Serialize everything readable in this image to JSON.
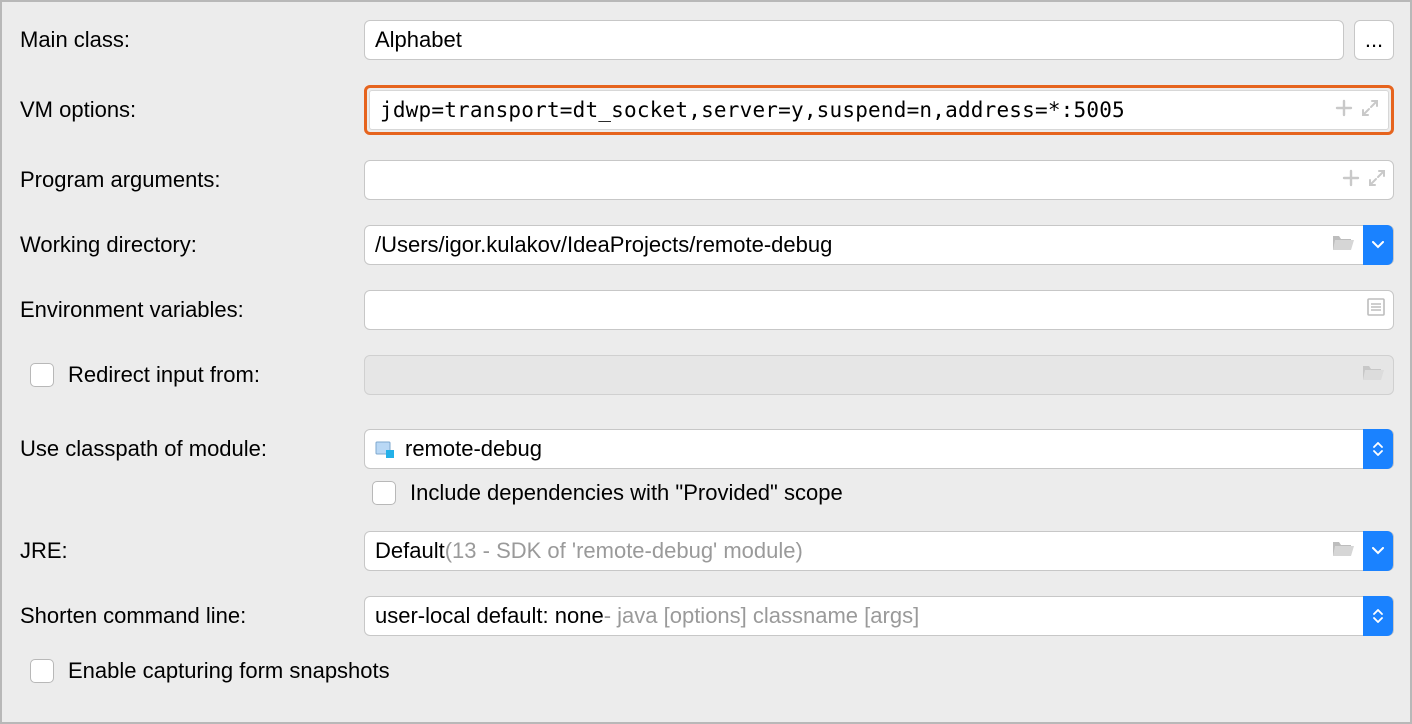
{
  "labels": {
    "main_class": "Main class:",
    "vm_options": "VM options:",
    "program_arguments": "Program arguments:",
    "working_directory": "Working directory:",
    "environment_variables": "Environment variables:",
    "redirect_input_from": "Redirect input from:",
    "use_classpath_of_module": "Use classpath of module:",
    "include_provided_scope": "Include dependencies with \"Provided\" scope",
    "jre": "JRE:",
    "shorten_command_line": "Shorten command line:",
    "enable_capturing_form_snapshots": "Enable capturing form snapshots"
  },
  "values": {
    "main_class": "Alphabet",
    "vm_options": "jdwp=transport=dt_socket,server=y,suspend=n,address=*:5005",
    "program_arguments": "",
    "working_directory": "/Users/igor.kulakov/IdeaProjects/remote-debug",
    "environment_variables": "",
    "redirect_input_from": "",
    "classpath_module": "remote-debug",
    "jre_main": "Default",
    "jre_hint": " (13 - SDK of 'remote-debug' module)",
    "shorten_main": "user-local default: none",
    "shorten_hint": " - java [options] classname [args]"
  },
  "buttons": {
    "ellipsis": "..."
  },
  "icons": {
    "plus": "plus-icon",
    "expand": "expand-icon",
    "folder": "folder-open-icon",
    "list": "list-icon",
    "module": "module-icon",
    "dropdown": "chevron-down-icon",
    "updown": "chevron-up-down-icon"
  },
  "checkboxes": {
    "redirect_input": false,
    "include_provided": false,
    "enable_snapshots": false
  }
}
